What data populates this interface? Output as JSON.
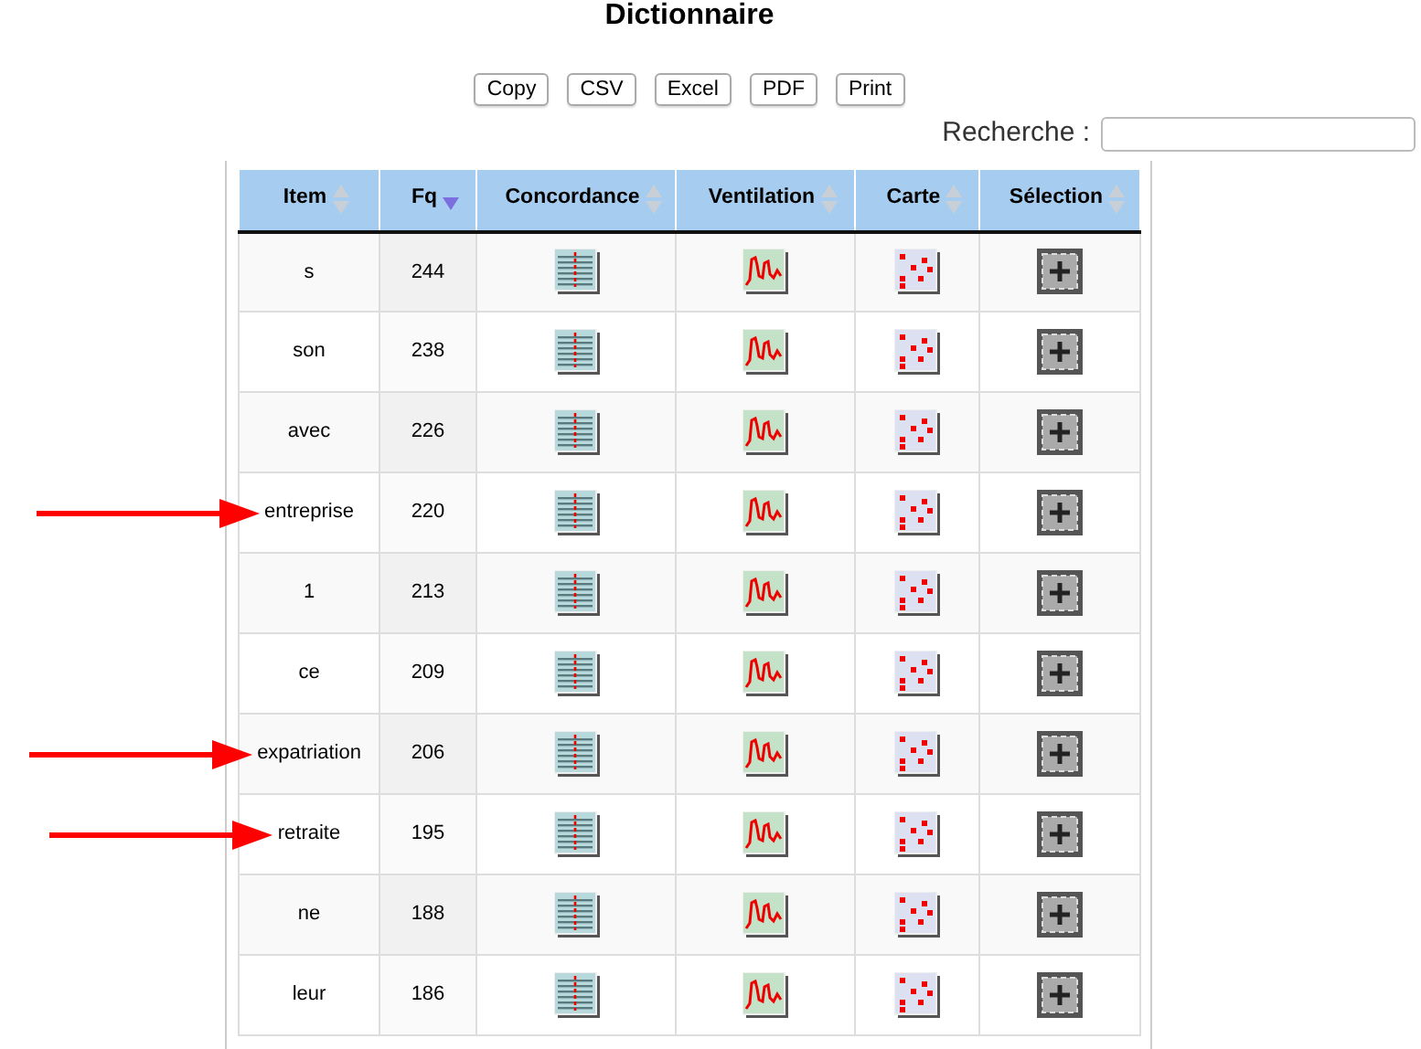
{
  "title": "Dictionnaire",
  "buttons": [
    "Copy",
    "CSV",
    "Excel",
    "PDF",
    "Print"
  ],
  "search": {
    "label": "Recherche :"
  },
  "table": {
    "columns": [
      {
        "label": "Item",
        "sorted": false,
        "kind": "term"
      },
      {
        "label": "Fq",
        "sorted": true,
        "kind": "frequency"
      },
      {
        "label": "Concordance",
        "sorted": false,
        "kind": "concordance"
      },
      {
        "label": "Ventilation",
        "sorted": false,
        "kind": "ventilation"
      },
      {
        "label": "Carte",
        "sorted": false,
        "kind": "map"
      },
      {
        "label": "Sélection",
        "sorted": false,
        "kind": "select"
      }
    ],
    "rows": [
      {
        "item": "s",
        "fq": "244",
        "marked": false
      },
      {
        "item": "son",
        "fq": "238",
        "marked": false
      },
      {
        "item": "avec",
        "fq": "226",
        "marked": false
      },
      {
        "item": "entreprise",
        "fq": "220",
        "marked": true
      },
      {
        "item": "1",
        "fq": "213",
        "marked": false
      },
      {
        "item": "ce",
        "fq": "209",
        "marked": false
      },
      {
        "item": "expatriation",
        "fq": "206",
        "marked": true
      },
      {
        "item": "retraite",
        "fq": "195",
        "marked": true
      },
      {
        "item": "ne",
        "fq": "188",
        "marked": false
      },
      {
        "item": "leur",
        "fq": "186",
        "marked": false
      }
    ]
  }
}
